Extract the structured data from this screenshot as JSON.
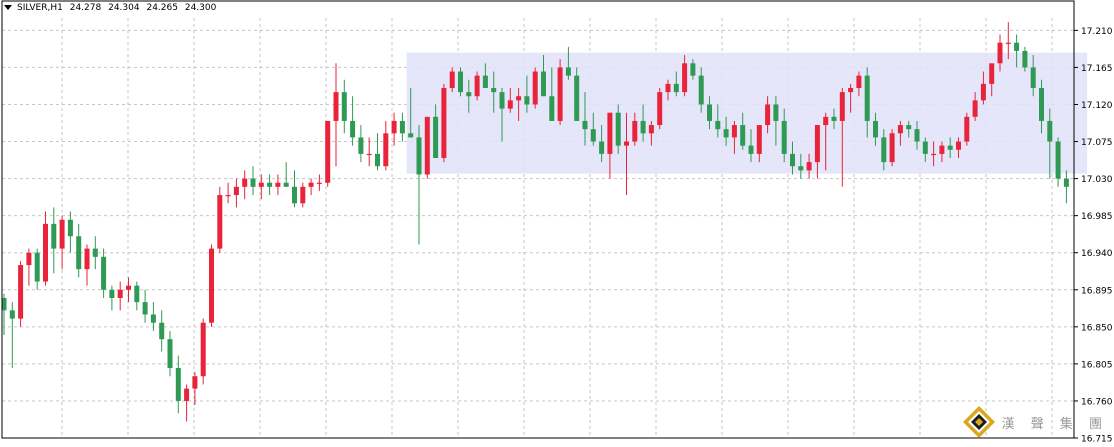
{
  "header": {
    "symbol": "SILVER,H1",
    "open": "24.278",
    "high": "24.304",
    "low": "24.265",
    "close": "24.300"
  },
  "watermark": {
    "text": "漢 聲 集 團"
  },
  "colors": {
    "bull": "#e8233a",
    "bear": "#2e9a53",
    "zone": "#e0e2f8",
    "grid": "#c6c6c6",
    "axis": "#000000"
  },
  "chart_data": {
    "type": "candlestick",
    "y_ticks": [
      "17.210",
      "17.165",
      "17.120",
      "17.075",
      "17.030",
      "16.985",
      "16.940",
      "16.895",
      "16.850",
      "16.805",
      "16.760",
      "16.715"
    ],
    "ylim": [
      16.715,
      17.225
    ],
    "grid": true,
    "highlight_zone": {
      "from_index": 49,
      "to_index": 130,
      "low": 17.036,
      "high": 17.183
    },
    "candles": [
      [
        16.885,
        16.89,
        16.84,
        16.87
      ],
      [
        16.87,
        16.88,
        16.8,
        16.86
      ],
      [
        16.86,
        16.93,
        16.85,
        16.925
      ],
      [
        16.925,
        16.945,
        16.9,
        16.94
      ],
      [
        16.94,
        16.945,
        16.895,
        16.905
      ],
      [
        16.905,
        16.99,
        16.9,
        16.975
      ],
      [
        16.975,
        16.995,
        16.915,
        16.945
      ],
      [
        16.945,
        16.985,
        16.92,
        16.98
      ],
      [
        16.98,
        16.99,
        16.94,
        16.96
      ],
      [
        16.96,
        16.975,
        16.91,
        16.92
      ],
      [
        16.92,
        16.95,
        16.9,
        16.945
      ],
      [
        16.945,
        16.96,
        16.92,
        16.935
      ],
      [
        16.935,
        16.945,
        16.885,
        16.895
      ],
      [
        16.895,
        16.9,
        16.87,
        16.885
      ],
      [
        16.885,
        16.905,
        16.87,
        16.895
      ],
      [
        16.895,
        16.91,
        16.88,
        16.9
      ],
      [
        16.9,
        16.905,
        16.87,
        16.88
      ],
      [
        16.88,
        16.895,
        16.855,
        16.865
      ],
      [
        16.865,
        16.88,
        16.845,
        16.855
      ],
      [
        16.855,
        16.87,
        16.82,
        16.835
      ],
      [
        16.835,
        16.845,
        16.79,
        16.8
      ],
      [
        16.8,
        16.815,
        16.745,
        16.76
      ],
      [
        16.76,
        16.78,
        16.735,
        16.775
      ],
      [
        16.775,
        16.795,
        16.755,
        16.79
      ],
      [
        16.79,
        16.86,
        16.78,
        16.855
      ],
      [
        16.855,
        16.95,
        16.85,
        16.945
      ],
      [
        16.945,
        17.02,
        16.94,
        17.01
      ],
      [
        17.01,
        17.025,
        17.0,
        17.01
      ],
      [
        17.01,
        17.03,
        16.995,
        17.02
      ],
      [
        17.02,
        17.04,
        17.005,
        17.03
      ],
      [
        17.03,
        17.045,
        17.01,
        17.02
      ],
      [
        17.02,
        17.035,
        17.005,
        17.025
      ],
      [
        17.025,
        17.035,
        17.01,
        17.02
      ],
      [
        17.02,
        17.035,
        17.01,
        17.025
      ],
      [
        17.025,
        17.05,
        17.02,
        17.02
      ],
      [
        17.02,
        17.04,
        16.995,
        17.0
      ],
      [
        17.0,
        17.025,
        16.995,
        17.02
      ],
      [
        17.02,
        17.03,
        17.01,
        17.025
      ],
      [
        17.025,
        17.035,
        17.015,
        17.025
      ],
      [
        17.025,
        17.06,
        17.02,
        17.1
      ],
      [
        17.1,
        17.17,
        17.045,
        17.135
      ],
      [
        17.135,
        17.15,
        17.085,
        17.1
      ],
      [
        17.1,
        17.13,
        17.07,
        17.08
      ],
      [
        17.08,
        17.095,
        17.05,
        17.06
      ],
      [
        17.06,
        17.08,
        17.045,
        17.06
      ],
      [
        17.06,
        17.085,
        17.04,
        17.045
      ],
      [
        17.045,
        17.1,
        17.04,
        17.085
      ],
      [
        17.085,
        17.11,
        17.07,
        17.1
      ],
      [
        17.1,
        17.11,
        17.075,
        17.085
      ],
      [
        17.085,
        17.14,
        17.08,
        17.08
      ],
      [
        17.08,
        17.095,
        16.95,
        17.035
      ],
      [
        17.035,
        17.09,
        17.03,
        17.105
      ],
      [
        17.105,
        17.12,
        17.06,
        17.055
      ],
      [
        17.055,
        17.145,
        17.05,
        17.14
      ],
      [
        17.14,
        17.165,
        17.135,
        17.16
      ],
      [
        17.16,
        17.165,
        17.13,
        17.135
      ],
      [
        17.135,
        17.15,
        17.11,
        17.13
      ],
      [
        17.13,
        17.16,
        17.125,
        17.155
      ],
      [
        17.155,
        17.17,
        17.14,
        17.14
      ],
      [
        17.14,
        17.16,
        17.11,
        17.135
      ],
      [
        17.135,
        17.14,
        17.075,
        17.115
      ],
      [
        17.115,
        17.14,
        17.11,
        17.125
      ],
      [
        17.125,
        17.14,
        17.1,
        17.13
      ],
      [
        17.13,
        17.155,
        17.11,
        17.12
      ],
      [
        17.12,
        17.165,
        17.115,
        17.16
      ],
      [
        17.16,
        17.18,
        17.135,
        17.13
      ],
      [
        17.13,
        17.165,
        17.1,
        17.1
      ],
      [
        17.1,
        17.175,
        17.095,
        17.165
      ],
      [
        17.165,
        17.19,
        17.15,
        17.155
      ],
      [
        17.155,
        17.165,
        17.1,
        17.1
      ],
      [
        17.1,
        17.135,
        17.07,
        17.09
      ],
      [
        17.09,
        17.11,
        17.07,
        17.075
      ],
      [
        17.075,
        17.095,
        17.05,
        17.06
      ],
      [
        17.06,
        17.08,
        17.03,
        17.11
      ],
      [
        17.11,
        17.12,
        17.06,
        17.07
      ],
      [
        17.07,
        17.11,
        17.01,
        17.075
      ],
      [
        17.075,
        17.11,
        17.07,
        17.1
      ],
      [
        17.1,
        17.12,
        17.075,
        17.085
      ],
      [
        17.085,
        17.1,
        17.07,
        17.095
      ],
      [
        17.095,
        17.14,
        17.09,
        17.135
      ],
      [
        17.135,
        17.15,
        17.125,
        17.145
      ],
      [
        17.145,
        17.16,
        17.13,
        17.135
      ],
      [
        17.135,
        17.18,
        17.13,
        17.17
      ],
      [
        17.17,
        17.175,
        17.15,
        17.155
      ],
      [
        17.155,
        17.165,
        17.11,
        17.12
      ],
      [
        17.12,
        17.13,
        17.09,
        17.1
      ],
      [
        17.1,
        17.12,
        17.08,
        17.09
      ],
      [
        17.09,
        17.105,
        17.07,
        17.08
      ],
      [
        17.08,
        17.1,
        17.06,
        17.095
      ],
      [
        17.095,
        17.11,
        17.065,
        17.07
      ],
      [
        17.07,
        17.09,
        17.05,
        17.06
      ],
      [
        17.06,
        17.08,
        17.05,
        17.095
      ],
      [
        17.095,
        17.13,
        17.085,
        17.12
      ],
      [
        17.12,
        17.13,
        17.07,
        17.1
      ],
      [
        17.1,
        17.115,
        17.05,
        17.06
      ],
      [
        17.06,
        17.075,
        17.035,
        17.045
      ],
      [
        17.045,
        17.06,
        17.03,
        17.04
      ],
      [
        17.04,
        17.06,
        17.03,
        17.05
      ],
      [
        17.05,
        17.06,
        17.03,
        17.095
      ],
      [
        17.095,
        17.11,
        17.04,
        17.105
      ],
      [
        17.105,
        17.115,
        17.09,
        17.1
      ],
      [
        17.1,
        17.14,
        17.02,
        17.135
      ],
      [
        17.135,
        17.145,
        17.11,
        17.14
      ],
      [
        17.14,
        17.16,
        17.13,
        17.155
      ],
      [
        17.155,
        17.165,
        17.08,
        17.1
      ],
      [
        17.1,
        17.11,
        17.07,
        17.08
      ],
      [
        17.08,
        17.09,
        17.04,
        17.05
      ],
      [
        17.05,
        17.09,
        17.045,
        17.085
      ],
      [
        17.085,
        17.1,
        17.07,
        17.095
      ],
      [
        17.095,
        17.1,
        17.08,
        17.09
      ],
      [
        17.09,
        17.1,
        17.065,
        17.075
      ],
      [
        17.075,
        17.08,
        17.05,
        17.06
      ],
      [
        17.06,
        17.075,
        17.045,
        17.06
      ],
      [
        17.06,
        17.075,
        17.05,
        17.07
      ],
      [
        17.07,
        17.08,
        17.055,
        17.065
      ],
      [
        17.065,
        17.08,
        17.055,
        17.075
      ],
      [
        17.075,
        17.11,
        17.07,
        17.105
      ],
      [
        17.105,
        17.135,
        17.1,
        17.125
      ],
      [
        17.125,
        17.16,
        17.12,
        17.145
      ],
      [
        17.145,
        17.165,
        17.13,
        17.17
      ],
      [
        17.17,
        17.205,
        17.16,
        17.195
      ],
      [
        17.195,
        17.22,
        17.175,
        17.195
      ],
      [
        17.195,
        17.205,
        17.165,
        17.185
      ],
      [
        17.185,
        17.19,
        17.16,
        17.165
      ],
      [
        17.165,
        17.18,
        17.13,
        17.14
      ],
      [
        17.14,
        17.15,
        17.085,
        17.1
      ],
      [
        17.1,
        17.115,
        17.03,
        17.075
      ],
      [
        17.075,
        17.08,
        17.02,
        17.03
      ],
      [
        17.03,
        17.04,
        17.0,
        17.02
      ],
      [
        17.02,
        17.03,
        16.985,
        16.995
      ],
      [
        16.995,
        17.03,
        16.97,
        17.0
      ]
    ]
  }
}
